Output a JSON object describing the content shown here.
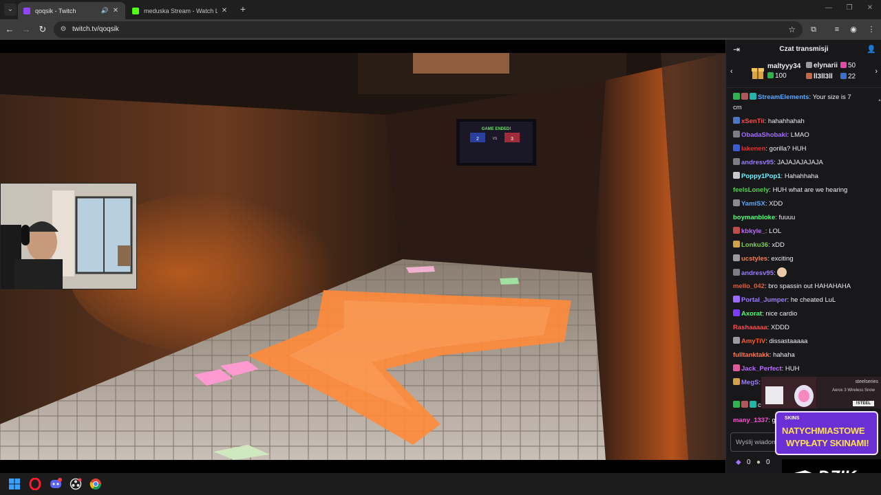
{
  "browser": {
    "tabs": [
      {
        "title": "qoqsik - Twitch",
        "active": true,
        "favicon_color": "#9146ff"
      },
      {
        "title": "meduska Stream - Watch Live o",
        "active": false,
        "favicon_color": "#53fc18"
      }
    ],
    "url": "twitch.tv/qoqsik"
  },
  "chat": {
    "header_title": "Czat transmisji",
    "leaderboard": {
      "top_gifter": {
        "name": "maltyyy34",
        "value": "100"
      },
      "entries": [
        {
          "name": "elynarii",
          "value": "50"
        },
        {
          "name": "ll3ll3ll",
          "value": "22"
        }
      ]
    },
    "messages": [
      {
        "user": "StreamElements",
        "color": "#5aa9ff",
        "text": "Your size is 7",
        "text2": "cm",
        "badges": [
          "#2bb34c",
          "#b0565e",
          "#22b5a8"
        ]
      },
      {
        "user": "xSenTii",
        "color": "#ff4b4b",
        "text": "hahahhahah",
        "badges": [
          "#4b77c4"
        ]
      },
      {
        "user": "ObadaShobaki",
        "color": "#a46cff",
        "text": "LMAO",
        "badges": [
          "#7d7d85"
        ]
      },
      {
        "user": "lakenen",
        "color": "#e02e2e",
        "text": "gorilla? HUH",
        "badges": [
          "#3b5fd0"
        ]
      },
      {
        "user": "andresv95",
        "color": "#9b7cff",
        "text": "JAJAJAJAJAJA",
        "badges": [
          "#7d7d85"
        ]
      },
      {
        "user": "Poppy1Pop1",
        "color": "#6ff0ff",
        "text": "Hahahhaha",
        "badges": [
          "#c9c9c9"
        ]
      },
      {
        "user": "feelsLonely",
        "color": "#4ed44e",
        "text": "HUH what are we hearing",
        "badges": []
      },
      {
        "user": "YamiSX",
        "color": "#5aa9ff",
        "text": "XDD",
        "badges": [
          "#8a8a8f"
        ]
      },
      {
        "user": "boymanbloke",
        "color": "#4cff7a",
        "text": "fuuuu",
        "badges": []
      },
      {
        "user": "kbkyle_",
        "color": "#b86cff",
        "text": "LOL",
        "badges": [
          "#c14a4a"
        ]
      },
      {
        "user": "Lonku36",
        "color": "#77d24a",
        "text": "xDD",
        "badges": [
          "#d2a14a"
        ]
      },
      {
        "user": "ucstyles",
        "color": "#ff7a4b",
        "text": "exciting",
        "badges": [
          "#9a9aa0"
        ]
      },
      {
        "user": "andresv95",
        "color": "#9b7cff",
        "text": "",
        "badges": [
          "#7d7d85"
        ],
        "emote": "emote-face"
      },
      {
        "user": "mello_042",
        "color": "#e0613a",
        "text": "bro spassin out HAHAHAHA",
        "badges": []
      },
      {
        "user": "Portal_Jumper",
        "color": "#9b7cff",
        "text": "he cheated LuL",
        "badges": [
          "#9b6cff"
        ]
      },
      {
        "user": "Axorat",
        "color": "#4cff7a",
        "text": "nice cardio",
        "badges": [
          "#7a3cff"
        ]
      },
      {
        "user": "Rashaaaaa",
        "color": "#ff4b4b",
        "text": "XDDD",
        "badges": []
      },
      {
        "user": "AmyTiV",
        "color": "#ff5a2e",
        "text": "dissastaaaaa",
        "badges": [
          "#9a9aa0"
        ]
      },
      {
        "user": "fulltanktakk",
        "color": "#ff7a4b",
        "text": "hahaha",
        "badges": []
      },
      {
        "user": "Jack_Perfect",
        "color": "#b86cff",
        "text": "HUH",
        "badges": [
          "#e05a9a"
        ]
      },
      {
        "user": "MegS",
        "color": "#9b7cff",
        "text": "",
        "badges": [
          "#d2a14a"
        ]
      },
      {
        "user": "",
        "color": "#efeff1",
        "text": "cm",
        "badges": [
          "#2bb34c",
          "#b0565e",
          "#22b5a8"
        ]
      },
      {
        "user": "many_1337",
        "color": "#ff4bd8",
        "text": "g",
        "badges": []
      }
    ],
    "input_placeholder": "Wyślij wiadom",
    "points": [
      {
        "icon": "bits-icon",
        "value": "0"
      },
      {
        "icon": "channel-points-icon",
        "value": "0"
      }
    ]
  },
  "stream_scene": {
    "screen_text": "GAME ENDED!",
    "screen_score": [
      "2",
      "VS",
      "3"
    ]
  },
  "overlays": {
    "steelseries": {
      "brand": "steelseries",
      "product": "Aerox 3 Wireless Snow",
      "cta": "!STEEL"
    },
    "skins_ad": {
      "brand": "SKINS",
      "line1": "NATYCHMIASTOWE",
      "line2": "WYPŁATY SKINAMI!"
    },
    "sponsor": "DZIK"
  },
  "taskbar": {
    "apps": [
      "windows-start-icon",
      "opera-icon",
      "discord-icon",
      "obs-icon",
      "chrome-icon"
    ]
  }
}
